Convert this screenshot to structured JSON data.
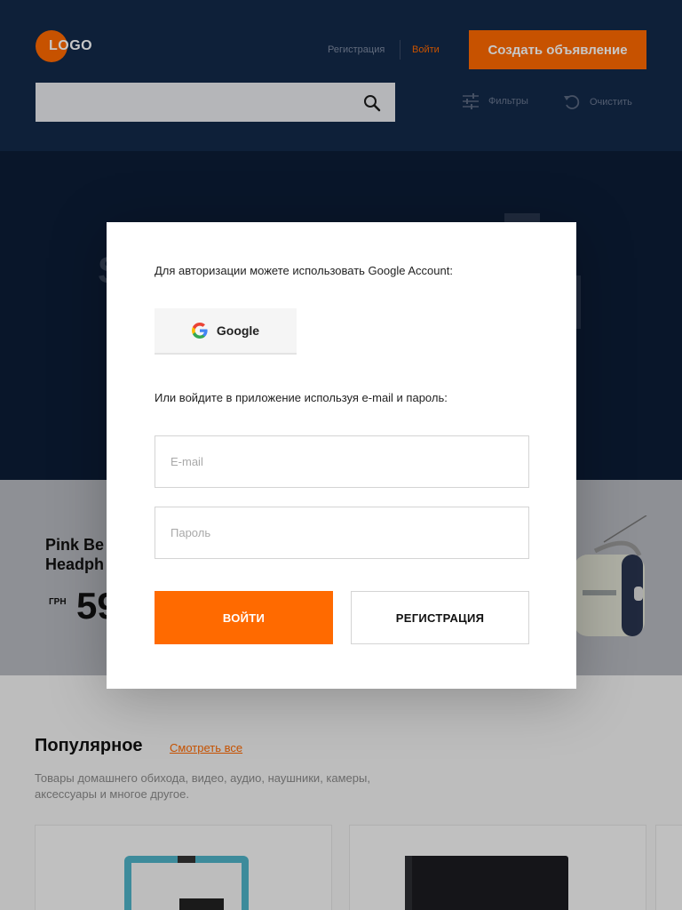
{
  "header": {
    "logo_text": "LOGO",
    "register_link": "Регистрация",
    "login_link": "Войти",
    "create_button": "Создать объявление",
    "search_value": "",
    "filters_label": "Фильтры",
    "clear_label": "Очистить",
    "search_icon": "search-icon",
    "filters_icon": "sliders-icon",
    "clear_icon": "refresh-icon"
  },
  "hero": {
    "partial_text": "S"
  },
  "featured": {
    "title_line1": "Pink Be",
    "title_line2": "Headph",
    "currency": "ГРН",
    "price_partial": "59"
  },
  "popular": {
    "title": "Популярное",
    "see_all": "Смотреть все",
    "description": "Товары домашнего обихода, видео, аудио, наушники, камеры, аксессуары и многое другое."
  },
  "modal": {
    "google_prompt": "Для авторизации можете использовать Google Account:",
    "google_button": "Google",
    "email_prompt": "Или войдите в приложение используя e-mail и пароль:",
    "email_placeholder": "E-mail",
    "password_placeholder": "Пароль",
    "login_button": "ВОЙТИ",
    "register_button": "РЕГИСТРАЦИЯ"
  },
  "colors": {
    "accent": "#ff6a00",
    "header_bg": "#13294a",
    "hero_bg": "#0c1d36"
  }
}
